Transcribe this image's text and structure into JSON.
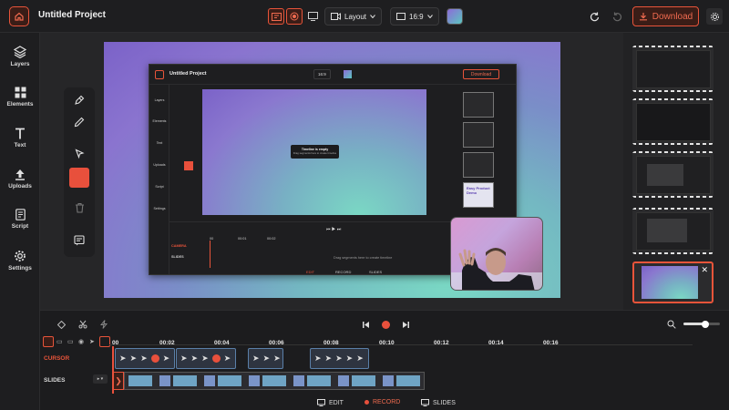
{
  "header": {
    "title": "Untitled Project",
    "layout_label": "Layout",
    "ratio_label": "16:9",
    "download_label": "Download",
    "accent": "#e8543a"
  },
  "sidebar": {
    "items": [
      {
        "label": "Layers",
        "icon": "layers-icon"
      },
      {
        "label": "Elements",
        "icon": "grid-icon"
      },
      {
        "label": "Text",
        "icon": "text-icon"
      },
      {
        "label": "Uploads",
        "icon": "upload-icon"
      },
      {
        "label": "Script",
        "icon": "script-icon"
      },
      {
        "label": "Settings",
        "icon": "gear-icon"
      }
    ]
  },
  "tools": {
    "items": [
      "pen-icon",
      "pencil-icon",
      "cursor-icon",
      "color-swatch",
      "trash-icon",
      "note-icon"
    ],
    "color": "#e8503c"
  },
  "nested": {
    "title": "Untitled Project",
    "ratio": "16:9",
    "download": "Download",
    "side": [
      "Layers",
      "Elements",
      "Text",
      "Uploads",
      "Script",
      "Settings"
    ],
    "tooltip_title": "Timeline is empty",
    "tooltip_body": "Drag segments here to create timeline",
    "tracks": [
      "CAMERA",
      "SLIDES"
    ],
    "drop_hint": "Drag segments here to create timeline",
    "modes": [
      "EDIT",
      "RECORD",
      "SLIDES"
    ],
    "ruler": [
      "00",
      "00:01",
      "00:02"
    ],
    "slide_text": "Easy Product Demo"
  },
  "timeline": {
    "ruler": [
      "00",
      "00:02",
      "00:04",
      "00:06",
      "00:08",
      "00:10",
      "00:12",
      "00:14",
      "00:16"
    ],
    "tracks": [
      {
        "label": "CURSOR",
        "color": "#e8543a"
      },
      {
        "label": "SLIDES",
        "color": "#d8d8d8"
      }
    ],
    "zoom_level": 0.6
  },
  "modes": {
    "edit": "EDIT",
    "record": "RECORD",
    "slides": "SLIDES"
  }
}
